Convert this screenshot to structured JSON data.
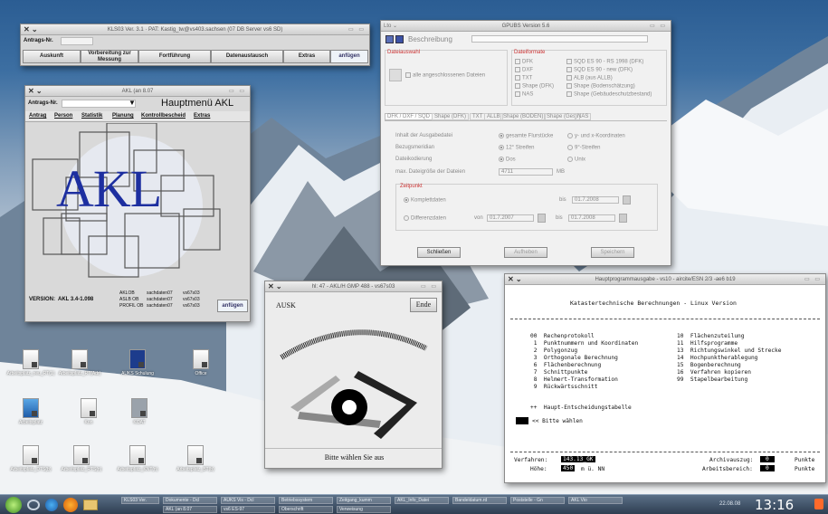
{
  "win_anmelden": {
    "title": "KLS03 Ver. 3.1 · PAT: Kastig_tw@vs403.sachsen (07 DB Server vs6 SD)",
    "auftrag_label": "Antrags-Nr.",
    "buttons": [
      "Auskunft",
      "Vorbereitung zur Messung",
      "Fortführung",
      "Datenaustausch",
      "Extras"
    ],
    "action": "anfügen"
  },
  "win_akl": {
    "title": "AKL (an 8.07",
    "auftrag_label": "Antrags-Nr.",
    "header": "Hauptmenü AKL",
    "tabs": [
      "Antrag",
      "Person",
      "Statistik",
      "Planung",
      "Kontrollbescheid",
      "Extras"
    ],
    "logo_text": "AKL",
    "version_label": "VERSION:",
    "version": "AKL 3.4-1.098",
    "info_rows": [
      [
        "AKLOB",
        "sachdaten07",
        "vs67s03"
      ],
      [
        "ASLB OB",
        "sachdaten07",
        "vs67s03"
      ],
      [
        "PROFIL OB",
        "sachdaten07",
        "vs67s03"
      ]
    ],
    "action": "anfügen"
  },
  "win_gpubs": {
    "title": "GPUBS Version 5.6",
    "beschreibung_label": "Beschreibung",
    "dateiauswahl_label": "Dateiauswahl",
    "checkbox_label": "alle angeschlossenen Dateien",
    "dateiformate_label": "Dateiformate",
    "formats_left": [
      "DFK",
      "DXF",
      "TXT",
      "Shape (DFK)",
      "NAS"
    ],
    "formats_right": [
      "SQD ES 90 - RS 1998 (DFK)",
      "SQD ES 90 - new (DFK)",
      "ALB (aus ALLB)",
      "Shape (Bodenschätzung)",
      "Shape (Gebäudeschutzbestand)"
    ],
    "tabs": [
      "DFK / DXF / SQD",
      "Shape (DFK)",
      "TXT",
      "ALLB",
      "Shape (BODEN)",
      "Shape (Ges)",
      "NAS"
    ],
    "rows": [
      {
        "label": "Inhalt der Ausgabedatei",
        "opt1": "gesamte Flurstücke",
        "opt2": "y- und x-Koordinaten"
      },
      {
        "label": "Bezugsmeridian",
        "opt1": "12° Streifen",
        "opt2": "9°-Streifen"
      },
      {
        "label": "Dateikodierung",
        "opt1": "Dos",
        "opt2": "Unix"
      }
    ],
    "max_label": "max. Dateigröße der Dateien",
    "max_value": "4711",
    "max_unit": "MB",
    "zeitpunkt_label": "Zeitpunkt",
    "komplett_label": "Komplettdaten",
    "diff_label": "Differenzdaten",
    "bis_label": "bis",
    "von_label": "von",
    "date1": "01.7.2008",
    "date2": "01.7.2007",
    "date3": "01.7.2008",
    "buttons": [
      "Schließen",
      "Aufheben",
      "Speichern"
    ]
  },
  "win_ausk": {
    "title": "hl: 47 - AKL/H GMP 488 - vs67s03",
    "ausk_label": "AUSK",
    "ende_label": "Ende",
    "status": "Bitte wählen Sie aus"
  },
  "win_kataster": {
    "title": "Hauptprogrammausgabe - vs10 - aircite/ESN 2/3 -ae6 b19",
    "heading": "Katastertechnische Berechnungen - Linux Version",
    "left": [
      "00  Rechenprotokoll",
      " 1  Punktnummern und Koordinaten",
      " 2  Polygonzug",
      " 3  Orthogonale Berechnung",
      " 6  Flächenberechnung",
      " 7  Schnittpunkte",
      " 8  Helmert-Transformation",
      " 9  Rückwärtsschnitt"
    ],
    "right": [
      "10  Flächenzuteilung",
      "11  Hilfsprogramme",
      "13  Richtungswinkel und Strecke",
      "14  Hochpunktherablegung",
      "15  Bogenberechnung",
      "16  Verfahren kopieren",
      "99  Stapelbearbeitung"
    ],
    "back": "++  Haupt-Entscheidungstabelle",
    "prompt": "<< Bitte wählen",
    "verfahren_label": "Verfahren:",
    "verfahren_value": "143.13_GK",
    "hoehe_label": "Höhe:",
    "hoehe_value": "450",
    "hoehe_unit": "m ü. NN",
    "archiv_label": "Archivauszug:",
    "archiv_value": "0",
    "arbeit_label": "Arbeitsbereich:",
    "arbeit_value": "0",
    "punkte": "Punkte"
  },
  "desktop_icons": [
    {
      "label": "Arbeitsplatz_neu_RT(1)"
    },
    {
      "label": "Arbeitsplatz_RT(Adr)"
    },
    {
      "label": "AUKS Schulung"
    },
    {
      "label": "Office"
    },
    {
      "label": "Arbeitsplatz"
    },
    {
      "label": "Kon"
    },
    {
      "label": "KOAT"
    },
    {
      "label": "Arbeitsplatz_DTS(b)"
    },
    {
      "label": "Arbeitsplatz_RTS(n)"
    },
    {
      "label": "Arbeitsplatz_KNT(n)"
    },
    {
      "label": "Arbeitsplatz_BT(b)"
    }
  ],
  "taskbar": {
    "tasks": [
      "KLS03 Ver.",
      "Dokumente - Dcl",
      "AUKS Vis - Dcl",
      "Betriebssystem",
      "Zeitgang_kumm",
      "AKL_Info_Datei",
      "Bandeldatum.rd",
      "Poststelle - Gn",
      "AKL Vio",
      "AKL (an 8.07",
      "vs6 ES-97",
      "Oberschrift",
      "Verweisung"
    ],
    "clock": "13:16",
    "tray_date": "22.08.08"
  }
}
